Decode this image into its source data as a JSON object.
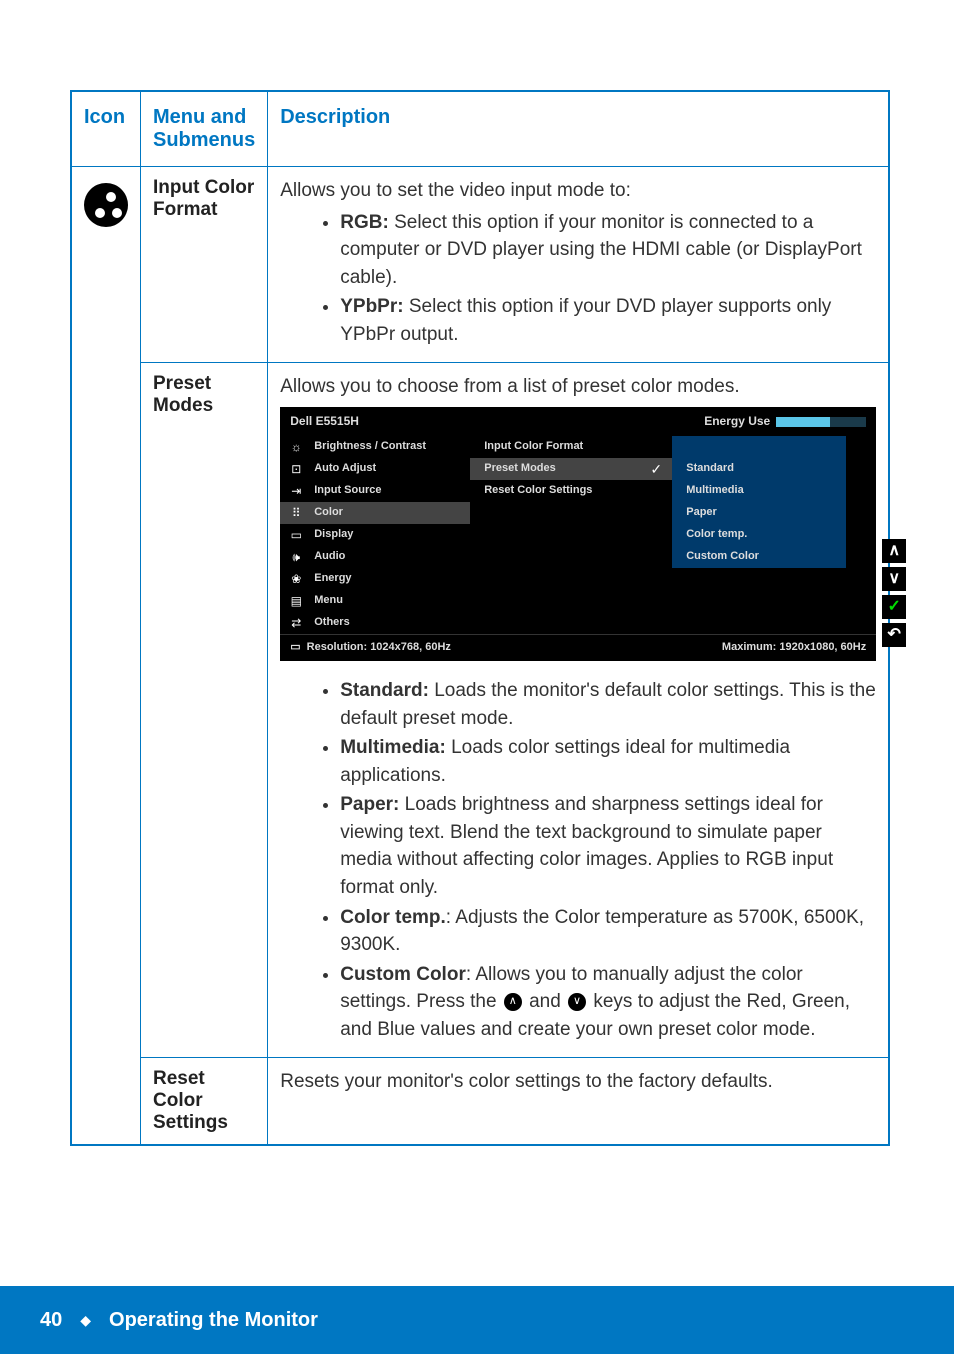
{
  "table": {
    "headers": {
      "icon": "Icon",
      "menu": "Menu and Submenus",
      "desc": "Description"
    }
  },
  "rows": {
    "inputColorFormat": {
      "label": "Input Color Format",
      "intro": "Allows you to set the video input mode to:",
      "rgb_label": "RGB:",
      "rgb_text": " Select this option if your monitor is connected to a computer or DVD player using the HDMI cable (or DisplayPort cable).",
      "ypbpr_label": "YPbPr:",
      "ypbpr_text": " Select this option if your DVD player supports only YPbPr output."
    },
    "presetModes": {
      "label": "Preset Modes",
      "intro": "Allows you to choose from a list of preset color modes.",
      "std_label": "Standard:",
      "std_text": " Loads the monitor's default color settings. This is the default preset mode.",
      "mm_label": "Multimedia:",
      "mm_text": " Loads color settings ideal for multimedia applications.",
      "paper_label": "Paper:",
      "paper_text": " Loads brightness and sharpness settings ideal for viewing text. Blend the text background to simulate paper media without affecting color images. Applies to RGB input format only.",
      "ct_label": "Color temp.",
      "ct_text": ": Adjusts the Color temperature as 5700K, 6500K, 9300K.",
      "cc_label": "Custom Color",
      "cc_text_a": ": Allows you to manually adjust the color settings. Press the ",
      "cc_text_b": " and ",
      "cc_text_c": " keys to adjust the Red, Green, and Blue values and create your own preset color mode."
    },
    "resetColor": {
      "label": "Reset Color Settings",
      "text": "Resets your monitor's color settings to the factory defaults."
    }
  },
  "osd": {
    "title": "Dell E5515H",
    "energy": "Energy Use",
    "menu": [
      {
        "icon": "☼",
        "label": "Brightness / Contrast"
      },
      {
        "icon": "⊡",
        "label": "Auto Adjust"
      },
      {
        "icon": "⇥",
        "label": "Input Source"
      },
      {
        "icon": "⠿",
        "label": "Color",
        "sel": true
      },
      {
        "icon": "▭",
        "label": "Display"
      },
      {
        "icon": "🕪",
        "label": "Audio"
      },
      {
        "icon": "❀",
        "label": "Energy"
      },
      {
        "icon": "▤",
        "label": "Menu"
      },
      {
        "icon": "⇄",
        "label": "Others"
      }
    ],
    "sub": [
      {
        "label": "Input Color Format"
      },
      {
        "label": "Preset Modes",
        "sel": true
      },
      {
        "label": "Reset Color Settings"
      }
    ],
    "presets": [
      {
        "label": "Standard",
        "sel": true
      },
      {
        "label": "Multimedia"
      },
      {
        "label": "Paper"
      },
      {
        "label": "Color temp."
      },
      {
        "label": "Custom Color"
      }
    ],
    "footer_left": "Resolution: 1024x768, 60Hz",
    "footer_right": "Maximum: 1920x1080, 60Hz",
    "side": [
      "∧",
      "∨",
      "✓",
      "↶"
    ]
  },
  "footer": {
    "page": "40",
    "title": "Operating the Monitor"
  }
}
